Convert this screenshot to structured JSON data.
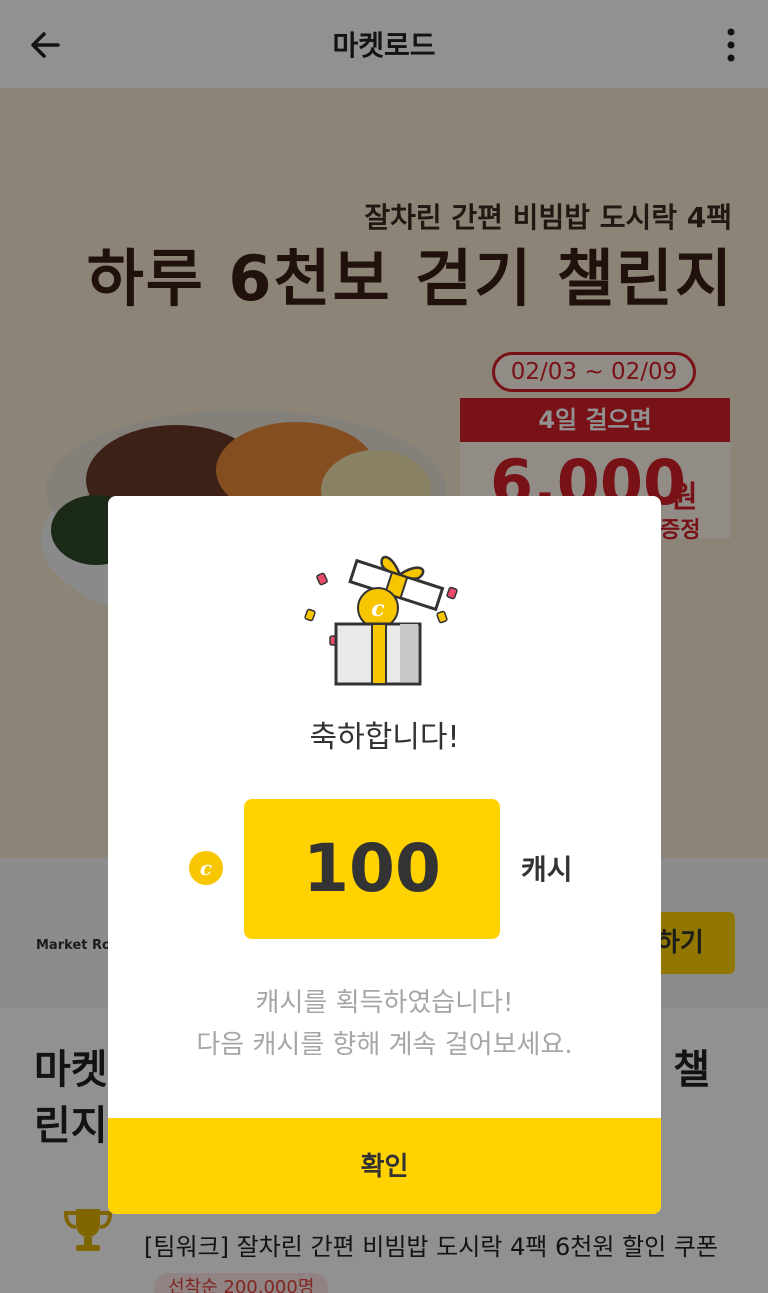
{
  "appbar": {
    "title": "마켓로드",
    "back_icon": "arrow-left-icon",
    "more_icon": "more-vertical-icon"
  },
  "banner": {
    "subtitle": "잘차린 간편 비빔밥 도시락 4팩",
    "headline": "하루 6천보 걷기 챌린지",
    "date_range": "02/03 ~ 02/09",
    "ticket_header": "4일 걸으면",
    "ticket_amount": "6,000",
    "ticket_unit": "원",
    "ticket_give": "증정",
    "colors": {
      "accent_red": "#d5202a",
      "background": "#f6ead2"
    }
  },
  "info": {
    "logo_text": "Market Road",
    "apply_label": "하기"
  },
  "page": {
    "heading_line1": "마켓",
    "heading_line1_end": "챌",
    "heading_line2": "린지",
    "coupon_title": "[팀워크] 잘차린 간편 비빔밥 도시락 4팩 6천원 할인 쿠폰",
    "limit_badge": "선착순 200,000명"
  },
  "modal": {
    "icon": "gift-box-icon",
    "congrats": "축하합니다!",
    "coin_icon": "cash-coin-icon",
    "amount": "100",
    "unit": "캐시",
    "desc_line1": "캐시를 획득하였습니다!",
    "desc_line2": "다음 캐시를 향해 계속 걸어보세요.",
    "confirm_label": "확인",
    "colors": {
      "primary": "#ffd200",
      "text": "#333333"
    }
  }
}
